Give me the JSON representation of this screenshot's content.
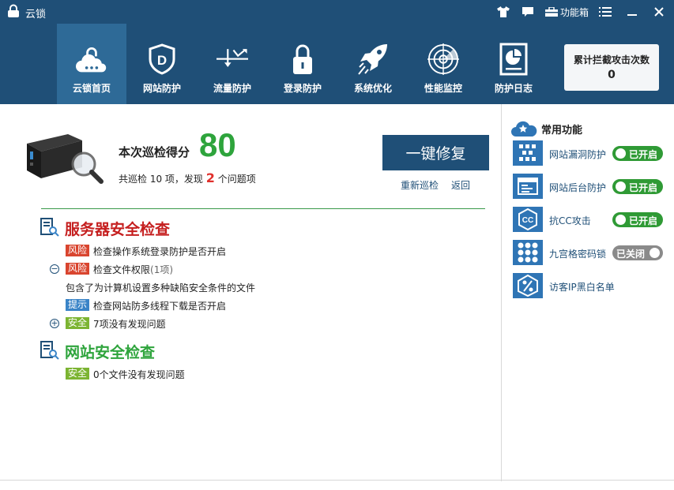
{
  "app": {
    "title": "云锁"
  },
  "titlebar": {
    "toolbox_label": "功能箱"
  },
  "nav": [
    {
      "label": "云锁首页",
      "icon": "cloud-lock-icon",
      "active": true
    },
    {
      "label": "网站防护",
      "icon": "shield-d-icon",
      "active": false
    },
    {
      "label": "流量防护",
      "icon": "traffic-arrow-icon",
      "active": false
    },
    {
      "label": "登录防护",
      "icon": "padlock-icon",
      "active": false
    },
    {
      "label": "系统优化",
      "icon": "rocket-icon",
      "active": false
    },
    {
      "label": "性能监控",
      "icon": "radar-icon",
      "active": false
    },
    {
      "label": "防护日志",
      "icon": "log-document-icon",
      "active": false
    }
  ],
  "counter": {
    "label": "累计拦截攻击次数",
    "value": "0"
  },
  "scan": {
    "score_label": "本次巡检得分",
    "score": "80",
    "summary_prefix": "共巡检 10 项，发现",
    "problem_count": "2",
    "summary_suffix": "个问题项",
    "fix_button": "一键修复",
    "rescan_link": "重新巡检",
    "back_link": "返回"
  },
  "server_section": {
    "title": "服务器安全检查",
    "items": [
      {
        "badge": "风险",
        "text": "检查操作系统登录防护是否开启"
      },
      {
        "badge": "风险",
        "text": "检查文件权限",
        "count": "(1项)",
        "detail": "包含了为计算机设置多种缺陷安全条件的文件"
      },
      {
        "badge": "提示",
        "text": "检查网站防多线程下载是否开启"
      },
      {
        "badge": "安全",
        "text": "7项没有发现问题"
      }
    ]
  },
  "web_section": {
    "title": "网站安全检查",
    "items": [
      {
        "badge": "安全",
        "text": "0个文件没有发现问题"
      }
    ]
  },
  "sidebar": {
    "title": "常用功能",
    "items": [
      {
        "label": "网站漏洞防护",
        "icon": "vulnerability-shield-icon",
        "toggle": "已开启",
        "on": true
      },
      {
        "label": "网站后台防护",
        "icon": "admin-panel-icon",
        "toggle": "已开启",
        "on": true
      },
      {
        "label": "抗CC攻击",
        "icon": "cc-attack-icon",
        "toggle": "已开启",
        "on": true
      },
      {
        "label": "九宫格密码锁",
        "icon": "grid-lock-icon",
        "toggle": "已关闭",
        "on": false
      },
      {
        "label": "访客IP黑白名单",
        "icon": "ip-list-icon"
      }
    ]
  },
  "colors": {
    "header": "#1f4f77",
    "active_nav": "#2e6a97",
    "score": "#2ea43c",
    "risk": "#d9452f",
    "tip": "#3a84c7",
    "safe": "#7cb432",
    "toggle_on": "#2f9a35",
    "toggle_off": "#8a8a8a"
  }
}
